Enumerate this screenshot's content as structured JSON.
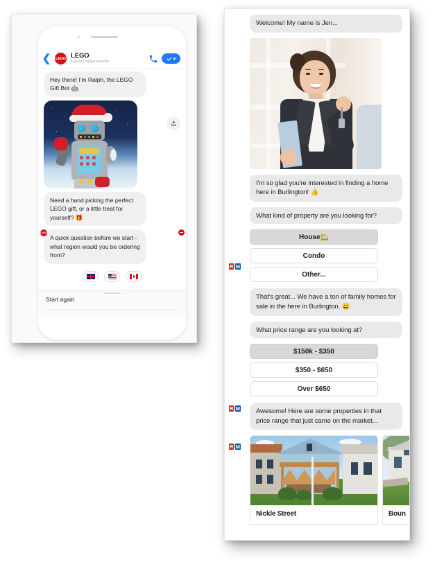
{
  "left_panel": {
    "header": {
      "back_icon": "chevron-left-icon",
      "avatar_label": "LEGO",
      "title": "LEGO",
      "subtitle": "Typically replies instantly",
      "call_icon": "phone-icon",
      "verified_icon": "check-icon"
    },
    "messages": [
      {
        "type": "text",
        "text": "Hey there! I'm Ralph, the LEGO Gift Bot 🤖"
      },
      {
        "type": "image",
        "alt": "lego-santa-robot-image"
      },
      {
        "type": "text",
        "text": "Need a hand picking the perfect LEGO gift, or a little treat for yourself? 🎁"
      },
      {
        "type": "text",
        "text": "A quick question before we start - what region would you be ordering from?"
      }
    ],
    "share_icon": "share-icon",
    "quick_replies": [
      {
        "label": "United Kingdom",
        "flag": "flag-uk"
      },
      {
        "label": "United States",
        "flag": "flag-us"
      },
      {
        "label": "Canada",
        "flag": "flag-ca"
      }
    ],
    "footer": {
      "start_again": "Start again",
      "drag_handle": "drag-handle"
    }
  },
  "right_panel": {
    "messages": [
      {
        "type": "text",
        "text": "Welcome! My name is Jen..."
      },
      {
        "type": "image",
        "alt": "real-estate-agent-photo"
      },
      {
        "type": "text",
        "text": "I'm so glad you're interested in finding a home here in Burlington! 👍"
      },
      {
        "type": "text",
        "text": "What kind of property are you looking for?"
      }
    ],
    "property_options": [
      {
        "label": "House🏡",
        "selected": true
      },
      {
        "label": "Condo",
        "selected": false
      },
      {
        "label": "Other...",
        "selected": false
      }
    ],
    "followup_1": "That's great... We have a ton of family homes for sale in the here in Burlington. 😀",
    "price_question": "What price range are you looking at?",
    "price_options": [
      {
        "label": "$150k - $350",
        "selected": true
      },
      {
        "label": "$350 - $650",
        "selected": false
      },
      {
        "label": "Over $650",
        "selected": false
      }
    ],
    "followup_2": "Awesome! Here are some properties in that price range that just came on the market...",
    "listings": [
      {
        "title": "Nickle Street",
        "alt": "blue-house-photo"
      },
      {
        "title": "Boun",
        "alt": "white-house-photo"
      }
    ],
    "brand_logo": {
      "left": "R",
      "slash": "/",
      "right": "M"
    }
  },
  "colors": {
    "accent_blue": "#1e7bf5",
    "lego_red": "#d01012",
    "bubble_gray": "#f0f0f0",
    "bubble_gray_right": "#e9e9e9",
    "selected_button": "#d8d8d8",
    "remax_red": "#d2232a",
    "remax_blue": "#0a5ca8"
  }
}
